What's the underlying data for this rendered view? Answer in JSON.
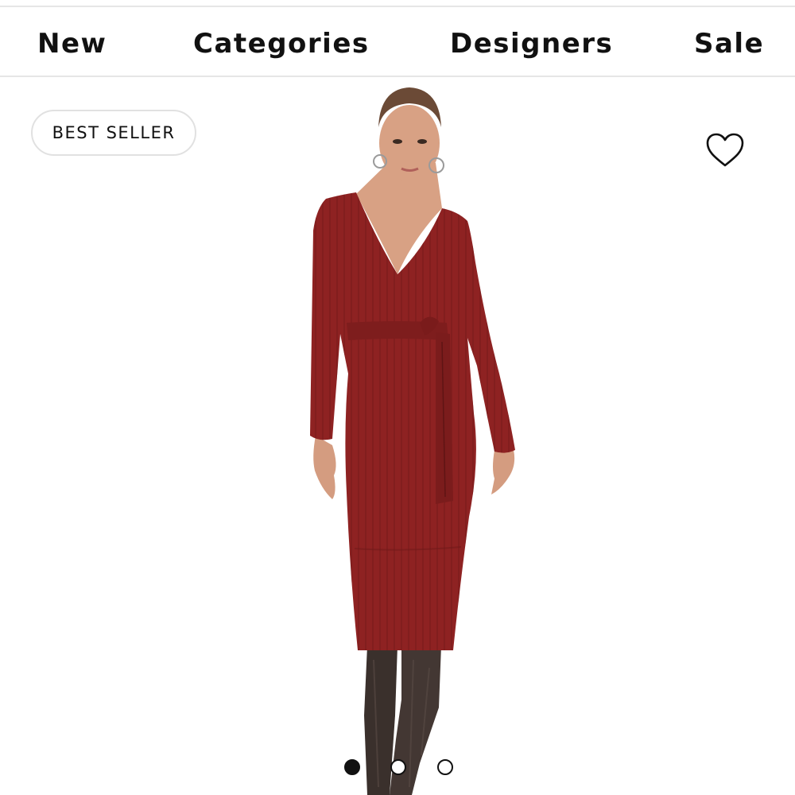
{
  "nav": {
    "items": [
      {
        "label": "New"
      },
      {
        "label": "Categories"
      },
      {
        "label": "Designers"
      },
      {
        "label": "Sale"
      }
    ]
  },
  "product": {
    "badge": "BEST SELLER",
    "wishlist_icon": "heart-outline-icon",
    "dress_color": "#8e2222"
  },
  "carousel": {
    "total": 3,
    "active_index": 0
  }
}
